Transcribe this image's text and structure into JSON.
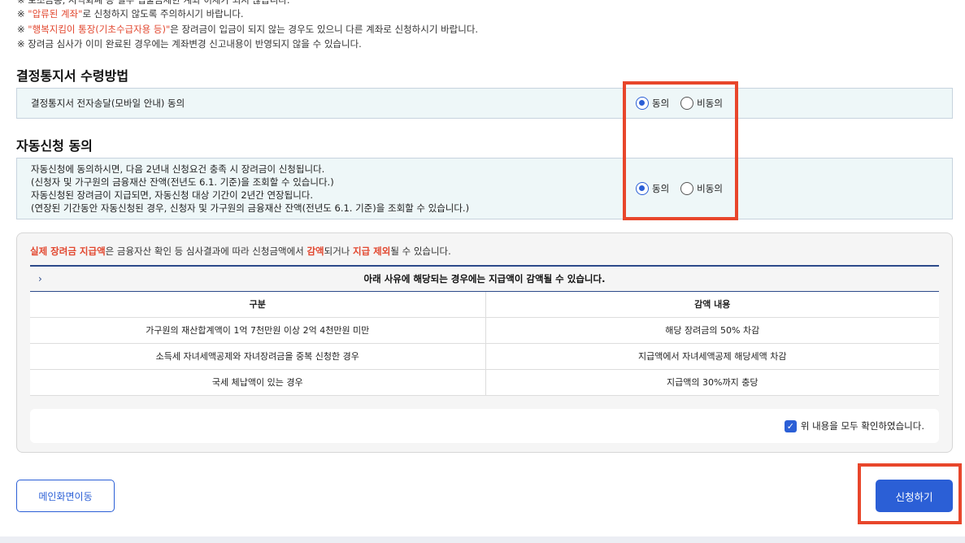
{
  "notices": {
    "line0": "※ 보조금통, 지역화폐 등 일부 입출금제한 계좌 이체가 되지 않습니다.",
    "line1_pre": "※ ",
    "line1_red": "\"압류된 계좌\"",
    "line1_post": "로 신청하지 않도록 주의하시기 바랍니다.",
    "line2_pre": "※ ",
    "line2_red": "\"행복지킴이 통장(기초수급자용 등)\"",
    "line2_post": "은 장려금이 입금이 되지 않는 경우도 있으니 다른 계좌로 신청하시기 바랍니다.",
    "line3": "※ 장려금 심사가 이미 완료된 경우에는 계좌변경 신고내용이 반영되지 않을 수 있습니다."
  },
  "decision": {
    "title": "결정통지서 수령방법",
    "row_label": "결정통지서 전자송달(모바일 안내) 동의",
    "agree_label": "동의",
    "disagree_label": "비동의"
  },
  "auto": {
    "title": "자동신청 동의",
    "line1": "자동신청에 동의하시면, 다음 2년내 신청요건 충족 시 장려금이 신청됩니다.",
    "line2": "(신청자 및 가구원의 금융재산 잔액(전년도 6.1. 기준)을 조회할 수 있습니다.)",
    "line3": "자동신청된 장려금이 지급되면, 자동신청 대상 기간이 2년간 연장됩니다.",
    "line4": "(연장된 기간동안 자동신청된 경우, 신청자 및 가구원의 금융재산 잔액(전년도 6.1. 기준)을 조회할 수 있습니다.)",
    "agree_label": "동의",
    "disagree_label": "비동의"
  },
  "info": {
    "head_red1": "실제 장려금 지급액",
    "head_mid1": "은 금융자산 확인 등 심사결과에 따라 신청금액에서 ",
    "head_red2": "감액",
    "head_mid2": "되거나 ",
    "head_red3": "지급 제외",
    "head_end": "될 수 있습니다.",
    "table_caption": "아래 사유에 해당되는 경우에는 지급액이 감액될 수 있습니다.",
    "col1": "구분",
    "col2": "감액 내용",
    "rows": [
      {
        "reason": "가구원의 재산합계액이 1억 7천만원 이상 2억 4천만원 미만",
        "detail": "해당 장려금의 50% 차감"
      },
      {
        "reason": "소득세 자녀세액공제와 자녀장려금을 중복 신청한 경우",
        "detail": "지급액에서 자녀세액공제 해당세액 차감"
      },
      {
        "reason": "국세 체납액이 있는 경우",
        "detail": "지급액의 30%까지 충당"
      }
    ],
    "confirm_label": "위 내용을 모두 확인하였습니다."
  },
  "buttons": {
    "main": "메인화면이동",
    "apply": "신청하기"
  },
  "colors": {
    "accent": "#2b5fd6",
    "highlight": "#e8462b",
    "red_text": "#e2472f"
  }
}
